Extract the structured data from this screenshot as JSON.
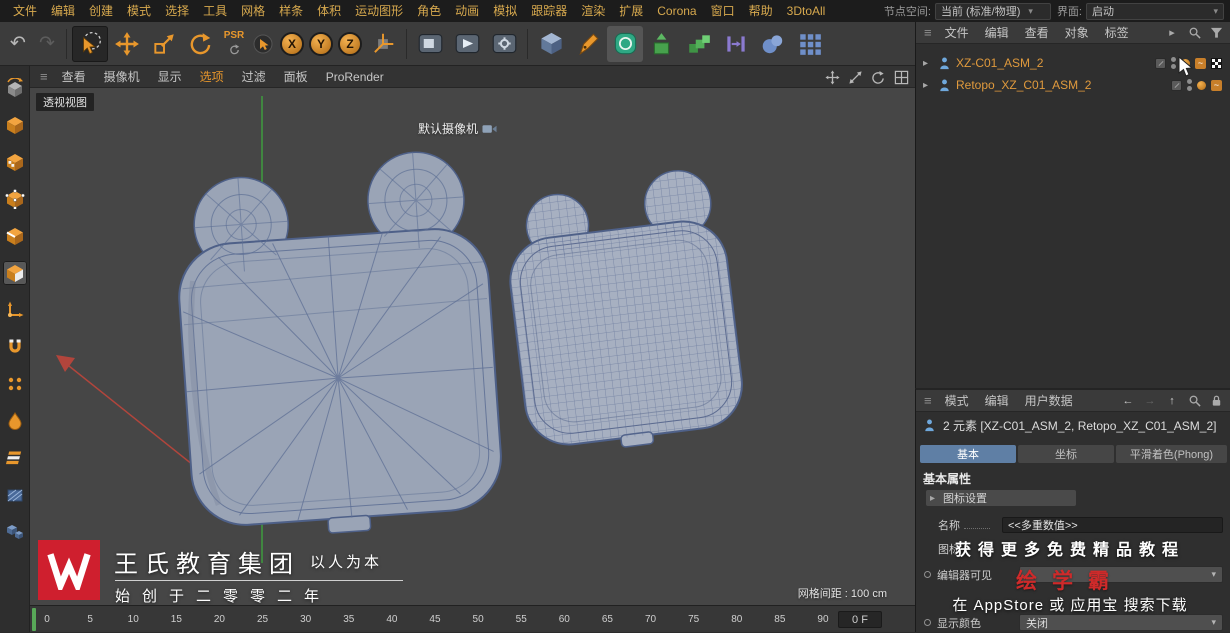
{
  "icons": {
    "grip": "≡",
    "caret_right": "▸",
    "caret_down": "▾",
    "undo": "↶",
    "redo": "↷",
    "back_arrow": "←",
    "forward_arrow": "→",
    "up_arrow": "↑"
  },
  "menu_bar": {
    "items": [
      "文件",
      "编辑",
      "创建",
      "模式",
      "选择",
      "工具",
      "网格",
      "样条",
      "体积",
      "运动图形",
      "角色",
      "动画",
      "模拟",
      "跟踪器",
      "渲染",
      "扩展",
      "Corona",
      "窗口",
      "帮助",
      "3DtoAll"
    ],
    "node_space_label": "节点空间:",
    "node_space_value": "当前 (标准/物理)",
    "interface_label": "界面:",
    "interface_value": "启动"
  },
  "toolbar": {
    "psr_label": "PSR",
    "axis_x": "X",
    "axis_y": "Y",
    "axis_z": "Z"
  },
  "viewport": {
    "menu_items": [
      "查看",
      "摄像机",
      "显示",
      "选项",
      "过滤",
      "面板",
      "ProRender"
    ],
    "active_menu": "选项",
    "view_label": "透视视图",
    "camera_label": "默认摄像机",
    "grid_spacing": "网格间距 : 100 cm"
  },
  "object_manager": {
    "menu_items": [
      "文件",
      "编辑",
      "查看",
      "对象",
      "标签"
    ],
    "objects": [
      {
        "name": "XZ-C01_ASM_2"
      },
      {
        "name": "Retopo_XZ_C01_ASM_2"
      }
    ]
  },
  "attribute_manager": {
    "menu_items": [
      "模式",
      "编辑",
      "用户数据"
    ],
    "selection_info": "2 元素 [XZ-C01_ASM_2, Retopo_XZ_C01_ASM_2]",
    "tabs": [
      "基本",
      "坐标",
      "平滑着色(Phong)"
    ],
    "active_tab": "基本",
    "section_title": "基本属性",
    "icon_settings_label": "图标设置",
    "name_label": "名称",
    "name_value": "<<多重数值>>",
    "icon_label": "图标",
    "editor_visible_label": "编辑器可见",
    "display_color_label": "显示颜色",
    "display_color_value": "关闭"
  },
  "timeline": {
    "ticks": [
      "0",
      "5",
      "10",
      "15",
      "20",
      "25",
      "30",
      "35",
      "40",
      "45",
      "50",
      "55",
      "60",
      "65",
      "70",
      "75",
      "80",
      "85",
      "90"
    ],
    "frame_field": "0 F"
  },
  "watermark": {
    "title": "王氏教育集团",
    "tagline": "以人为本",
    "subtitle": "始创于二零零二年"
  },
  "promo": {
    "line1": "获得更多免费精品教程",
    "line2": "绘学霸",
    "line3": "在 AppStore 或 应用宝 搜索下载"
  }
}
